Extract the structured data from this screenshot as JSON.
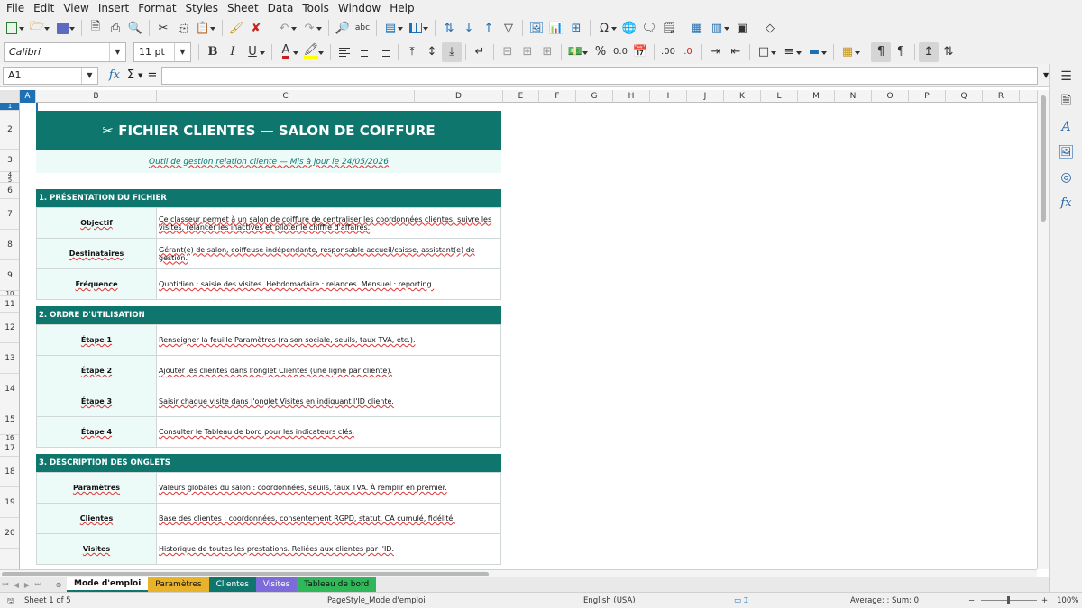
{
  "menu": [
    "File",
    "Edit",
    "View",
    "Insert",
    "Format",
    "Styles",
    "Sheet",
    "Data",
    "Tools",
    "Window",
    "Help"
  ],
  "format_bar": {
    "font_name": "Calibri",
    "font_size": "11 pt",
    "bold_label": "B",
    "italic_label": "I",
    "underline_label": "U",
    "font_color_label": "A",
    "percent_label": "%",
    "decimal_label": "0.0",
    "add_decimal_label": ".00",
    "del_decimal_label": ".0"
  },
  "formula_bar": {
    "name_box": "A1",
    "fx_label": "fx",
    "sigma_label": "Σ",
    "equals_label": "=",
    "content": ""
  },
  "columns": [
    {
      "label": "A",
      "selected": true
    },
    {
      "label": "B"
    },
    {
      "label": "C"
    },
    {
      "label": "D"
    },
    {
      "label": "E"
    },
    {
      "label": "F"
    },
    {
      "label": "G"
    },
    {
      "label": "H"
    },
    {
      "label": "I"
    },
    {
      "label": "J"
    },
    {
      "label": "K"
    },
    {
      "label": "L"
    },
    {
      "label": "M"
    },
    {
      "label": "N"
    },
    {
      "label": "O"
    },
    {
      "label": "P"
    },
    {
      "label": "Q"
    },
    {
      "label": "R"
    }
  ],
  "rows": [
    "1",
    "2",
    "3",
    "4",
    "5",
    "6",
    "7",
    "8",
    "9",
    "10",
    "11",
    "12",
    "13",
    "14",
    "15",
    "16",
    "17",
    "18",
    "19",
    "20"
  ],
  "sheet": {
    "title": "✂ FICHIER CLIENTES — SALON DE COIFFURE",
    "subtitle": "Outil de gestion relation cliente — Mis à jour le 24/05/2026",
    "sections": [
      {
        "header": "1. PRÉSENTATION DU FICHIER",
        "items": [
          {
            "label": "Objectif",
            "value": "Ce classeur permet à un salon de coiffure de centraliser les coordonnées clientes, suivre les visites, relancer les inactives et piloter le chiffre d'affaires."
          },
          {
            "label": "Destinataires",
            "value": "Gérant(e) de salon, coiffeuse indépendante, responsable accueil/caisse, assistant(e) de gestion."
          },
          {
            "label": "Fréquence",
            "value": "Quotidien : saisie des visites. Hebdomadaire : relances. Mensuel : reporting."
          }
        ]
      },
      {
        "header": "2. ORDRE D'UTILISATION",
        "items": [
          {
            "label": "Étape 1",
            "value": "Renseigner la feuille Paramètres (raison sociale, seuils, taux TVA, etc.)."
          },
          {
            "label": "Étape 2",
            "value": "Ajouter les clientes dans l'onglet Clientes (une ligne par cliente)."
          },
          {
            "label": "Étape 3",
            "value": "Saisir chaque visite dans l'onglet Visites en indiquant l'ID cliente."
          },
          {
            "label": "Étape 4",
            "value": "Consulter le Tableau de bord pour les indicateurs clés."
          }
        ]
      },
      {
        "header": "3. DESCRIPTION DES ONGLETS",
        "items": [
          {
            "label": "Paramètres",
            "value": "Valeurs globales du salon : coordonnées, seuils, taux TVA. À remplir en premier."
          },
          {
            "label": "Clientes",
            "value": "Base des clientes : coordonnées, consentement RGPD, statut, CA cumulé, fidélité."
          },
          {
            "label": "Visites",
            "value": "Historique de toutes les prestations. Reliées aux clientes par l'ID."
          }
        ]
      }
    ]
  },
  "tabs": [
    {
      "label": "Mode d'emploi",
      "color": "#ffffff",
      "active": true
    },
    {
      "label": "Paramètres",
      "color": "#e8b22a"
    },
    {
      "label": "Clientes",
      "color": "#0f766e"
    },
    {
      "label": "Visites",
      "color": "#7c6bd9"
    },
    {
      "label": "Tableau de bord",
      "color": "#2fb75a"
    }
  ],
  "status": {
    "sheet": "Sheet 1 of 5",
    "page_style": "PageStyle_Mode d'emploi",
    "language": "English (USA)",
    "summary": "Average: ; Sum: 0",
    "zoom": "100%"
  }
}
